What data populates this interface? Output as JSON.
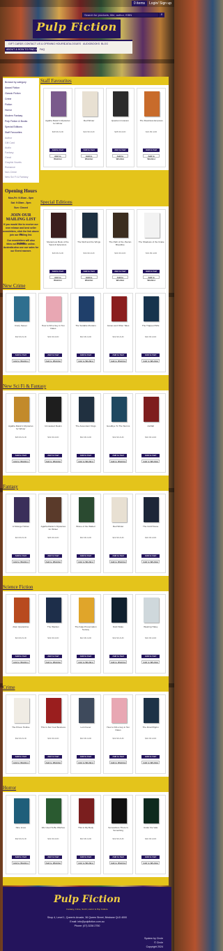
{
  "util": {
    "cart": "0 items",
    "login": "Login/ Sign up"
  },
  "search": {
    "placeholder": "Search for products, title, author, ISBN"
  },
  "logo": "Pulp Fiction",
  "nav": [
    "GIFT CARDS",
    "CONTACT US & OPENING HOURS",
    "CATALOGUES",
    "AUDIOBOOKS",
    "BLOG",
    "ABOUT & HOW TO FIND US",
    "FAQ"
  ],
  "sidebar": {
    "items": [
      "Browse by category",
      "Award Fiction",
      "Classic Fiction",
      "Crime",
      "Fiction",
      "Horror",
      "Modern Fantasy",
      "Pulp Fiction & Books",
      "Special Editions",
      "Staff Favourites"
    ],
    "subitems": [
      "Author",
      "Gift Card",
      "Audio",
      "Fantasy",
      "Great",
      "Graphic Novels",
      "Romance",
      "Non-Crime",
      "New Sci Fi & Fantasy",
      "Young Teenagers"
    ]
  },
  "hours": {
    "title": "Opening Hours",
    "lines": [
      "Mon-Fri: 9:30am - 6pm",
      "Sat: 9:30am - 5pm",
      "Sun: Closed"
    ],
    "mail_title": "JOIN OUR MAILING LIST",
    "mail_lines": [
      "If you would like to receive our",
      "new release and best seller",
      "newsletters, click the link above to",
      "join our mailing list.",
      "Our newsletters will also include",
      "titles not available online.",
      "Australia also use our sales for",
      "our Event manner."
    ]
  },
  "sections": [
    {
      "title": "Staff Favourites",
      "cards": [
        {
          "title": "Agatha Raisin's Mysteries for Winter",
          "price": "$28.99 AUD",
          "color": "#7a5a8c"
        },
        {
          "title": "Red Winter",
          "price": "$22.99 AUD",
          "color": "#e8e0d2"
        },
        {
          "title": "Quantum Invasion",
          "price": "$28.99 AUD",
          "color": "#2b2b2b"
        },
        {
          "title": "The Dauntless Empress",
          "price": "$24.99 AUD",
          "color": "#c86b2b"
        }
      ]
    },
    {
      "title": "Special Editions",
      "cards": [
        {
          "title": "Mysterious Book of the Sand & Splendors",
          "price": "$49.99 AUD",
          "color": "#3a1e1e"
        },
        {
          "title": "The Wolf and the Wings",
          "price": "$34.99 AUD",
          "color": "#1d3040"
        },
        {
          "title": "The Path of the Jhezan Bloodline",
          "price": "$34.99 AUD",
          "color": "#3b2d1f"
        },
        {
          "title": "The Shadows of the Crake",
          "price": "$34.99 AUD",
          "color": "#f2f2f2"
        }
      ]
    },
    {
      "title": "New Crime",
      "cards": [
        {
          "title": "Crazy Sweet",
          "price": "$32.99 AUD",
          "color": "#2f6f8f"
        },
        {
          "title": "How to Kill a Guy in Ten Dates",
          "price": "$32.99 AUD",
          "color": "#e8a7b3"
        },
        {
          "title": "The Suitable Murders",
          "price": "$32.99 AUD",
          "color": "#1f3f6a"
        },
        {
          "title": "James and Other Tales",
          "price": "$32.99 AUD",
          "color": "#8a1e1e"
        },
        {
          "title": "The Trapped Wife",
          "price": "$32.99 AUD",
          "color": "#16334d"
        }
      ]
    },
    {
      "title": "New Sci Fi & Fantasy",
      "cards": [
        {
          "title": "Agatha Raisin's Mysteries for Winter",
          "price": "$26.99 AUD",
          "color": "#c28a2b"
        },
        {
          "title": "Unmasked Realm",
          "price": "$32.99 AUD",
          "color": "#1e1e1e"
        },
        {
          "title": "The Ascendent Kings",
          "price": "$32.99 AUD",
          "color": "#203040"
        },
        {
          "title": "Goodbye To The Storms",
          "price": "$32.99 AUD",
          "color": "#1f4860"
        },
        {
          "title": "Ashfall",
          "price": "$32.99 AUD",
          "color": "#7e1e1e"
        }
      ]
    },
    {
      "title": "Fantasy",
      "cards": [
        {
          "title": "A Strange Hollow",
          "price": "$24.99 AUD",
          "color": "#3a2f5a"
        },
        {
          "title": "Agatha Raisin's Mysteries for Winter",
          "price": "$26.99 AUD",
          "color": "#5a3a2a"
        },
        {
          "title": "Brave of the Walled",
          "price": "$32.99 AUD",
          "color": "#2a4a30"
        },
        {
          "title": "Red Winter",
          "price": "$22.99 AUD",
          "color": "#e8e0d2"
        },
        {
          "title": "The Cold House",
          "price": "$32.99 AUD",
          "color": "#1c2638"
        }
      ]
    },
    {
      "title": "Science Fiction",
      "cards": [
        {
          "title": "Alien Quarantine",
          "price": "$24.99 AUD",
          "color": "#b84a1e"
        },
        {
          "title": "The Warden",
          "price": "$32.99 AUD",
          "color": "#1d2e4a"
        },
        {
          "title": "The Kaiju Preservation Society",
          "price": "$22.99 AUD",
          "color": "#e0a52a"
        },
        {
          "title": "Dark Wake",
          "price": "$32.99 AUD",
          "color": "#10202e"
        },
        {
          "title": "Wearing Haley",
          "price": "$32.99 AUD",
          "color": "#cfd8dc"
        }
      ]
    },
    {
      "title": "Crime",
      "cards": [
        {
          "title": "The Prison Hotline",
          "price": "$32.99 AUD",
          "color": "#f0ece4"
        },
        {
          "title": "This Is Not Your Business",
          "price": "$32.99 AUD",
          "color": "#9a1e1e"
        },
        {
          "title": "Lorn Fever",
          "price": "$32.99 AUD",
          "color": "#3e4a5c"
        },
        {
          "title": "How to Kill a Guy in Ten Dates",
          "price": "$32.99 AUD",
          "color": "#e8a7b3"
        },
        {
          "title": "The Final Pilgrim",
          "price": "$32.99 AUD",
          "color": "#1d3247"
        }
      ]
    },
    {
      "title": "Horror",
      "cards": [
        {
          "title": "Nine Lives",
          "price": "$32.99 AUD",
          "color": "#1f5e7a"
        },
        {
          "title": "We Used To Be Witches",
          "price": "$32.99 AUD",
          "color": "#2a5a30"
        },
        {
          "title": "This Is My Body",
          "price": "$32.99 AUD",
          "color": "#7a1e1e"
        },
        {
          "title": "Somewhere There Is Something",
          "price": "$32.99 AUD",
          "color": "#111"
        },
        {
          "title": "Under the Vale",
          "price": "$32.99 AUD",
          "color": "#0e2a1e"
        }
      ]
    }
  ],
  "card_buttons": {
    "add": "Add to Cart",
    "wish": "Add to Wishlist"
  },
  "footer": {
    "logo": "Pulp Fiction",
    "tagline": "Fantasy, Crime, Sci-Fi, Horror & Pop Culture",
    "lines": [
      "Shop 4, Level 1, Queen's Arcade, 36 Queen Street, Brisbane QLD 4000",
      "Email: info@pulpfiction.com.au",
      "Phone: (07) 3236 2750"
    ],
    "right": [
      "System by Circle",
      "© Circle",
      "Copyright 2024"
    ]
  }
}
